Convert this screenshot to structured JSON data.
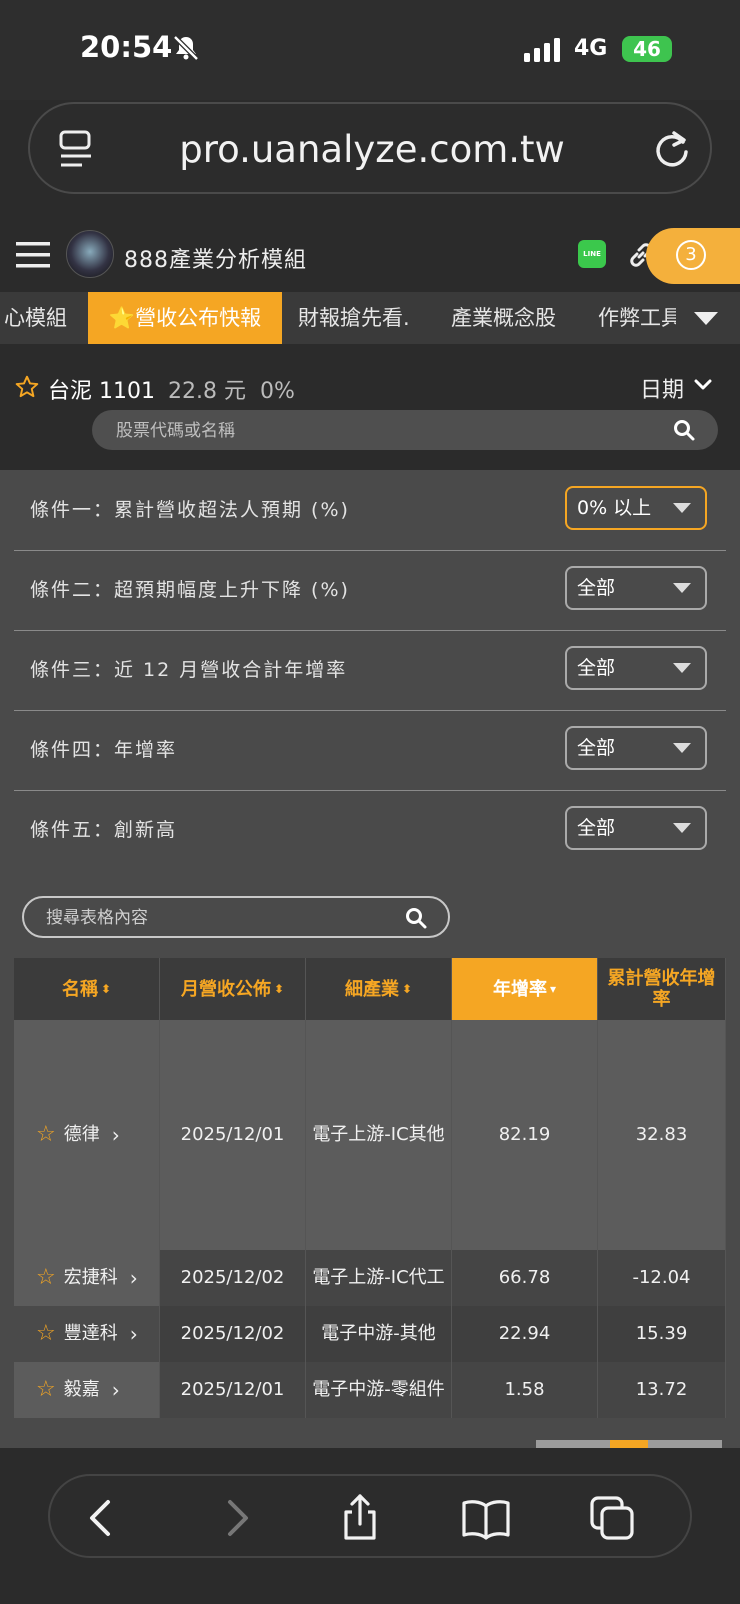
{
  "status": {
    "time": "20:54",
    "network": "4G",
    "battery": "46"
  },
  "browser": {
    "url": "pro.uanalyze.com.tw"
  },
  "app": {
    "title": "888產業分析模組",
    "notification_count": "3"
  },
  "tabs": [
    {
      "label": "心模組"
    },
    {
      "label": "⭐營收公布快報",
      "active": true
    },
    {
      "label": "財報搶先看."
    },
    {
      "label": "產業概念股"
    },
    {
      "label": "作弊工具"
    }
  ],
  "stock": {
    "name": "台泥 1101",
    "info": "22.8 元  0%",
    "date_label": "日期"
  },
  "stock_search": {
    "placeholder": "股票代碼或名稱"
  },
  "conditions": [
    {
      "label": "條件一：累計營收超法人預期 (%)",
      "value": "0% 以上",
      "highlight": true
    },
    {
      "label": "條件二：超預期幅度上升下降 (%)",
      "value": "全部"
    },
    {
      "label": "條件三：近 12 月營收合計年增率",
      "value": "全部"
    },
    {
      "label": "條件四：年增率",
      "value": "全部"
    },
    {
      "label": "條件五：創新高",
      "value": "全部"
    }
  ],
  "table_search": {
    "placeholder": "搜尋表格內容"
  },
  "table": {
    "headers": [
      "名稱",
      "月營收公佈",
      "細產業",
      "年增率",
      "累計營收年增率"
    ],
    "sorted_column": "年增率",
    "rows": [
      {
        "name": "德律",
        "date": "2025/12/01",
        "industry": "電子上游-IC其他",
        "yoy": "82.19",
        "cum_yoy": "32.83"
      },
      {
        "name": "宏捷科",
        "date": "2025/12/02",
        "industry": "電子上游-IC代工",
        "yoy": "66.78",
        "cum_yoy": "-12.04"
      },
      {
        "name": "豐達科",
        "date": "2025/12/02",
        "industry": "電子中游-其他",
        "yoy": "22.94",
        "cum_yoy": "15.39"
      },
      {
        "name": "毅嘉",
        "date": "2025/12/01",
        "industry": "電子中游-零組件",
        "yoy": "1.58",
        "cum_yoy": "13.72"
      }
    ]
  },
  "colors": {
    "accent": "#f5a623",
    "panel": "#4a4a4a",
    "line_green": "#3bc84c"
  }
}
